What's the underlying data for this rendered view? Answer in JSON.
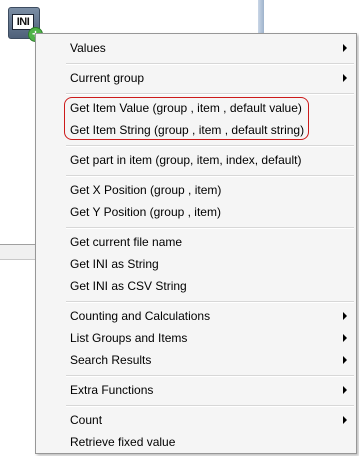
{
  "icon": {
    "name": "ini-config-icon",
    "text": "INI",
    "badge": "+"
  },
  "menu": {
    "items": [
      {
        "label": "Values",
        "submenu": true
      },
      {
        "label": "Current group",
        "submenu": true
      },
      {
        "label": "Get Item Value (group , item , default value)",
        "submenu": false
      },
      {
        "label": "Get Item String (group , item , default string)",
        "submenu": false
      },
      {
        "label": "Get part in item (group, item, index, default)",
        "submenu": false
      },
      {
        "label": "Get X Position (group , item)",
        "submenu": false
      },
      {
        "label": "Get Y Position (group , item)",
        "submenu": false
      },
      {
        "label": "Get current file name",
        "submenu": false
      },
      {
        "label": "Get INI as String",
        "submenu": false
      },
      {
        "label": "Get INI as CSV String",
        "submenu": false
      },
      {
        "label": "Counting and Calculations",
        "submenu": true
      },
      {
        "label": "List Groups and Items",
        "submenu": true
      },
      {
        "label": "Search Results",
        "submenu": true
      },
      {
        "label": "Extra Functions",
        "submenu": true
      },
      {
        "label": "Count",
        "submenu": true
      },
      {
        "label": "Retrieve fixed value",
        "submenu": false
      }
    ]
  },
  "colors": {
    "highlight_border": "#cc1a1a",
    "menu_background": "#f5f5f5"
  }
}
